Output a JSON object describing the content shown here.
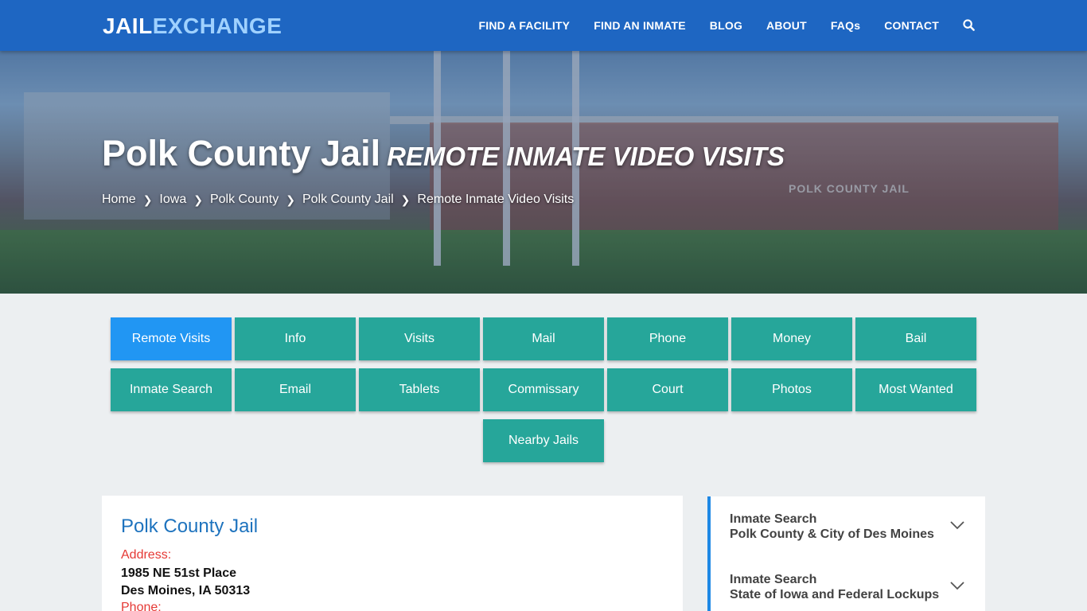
{
  "header": {
    "logo_part1": "JAIL",
    "logo_part2": "EXCHANGE",
    "nav": [
      "FIND A FACILITY",
      "FIND AN INMATE",
      "BLOG",
      "ABOUT",
      "FAQs",
      "CONTACT"
    ],
    "search_icon": "search-icon"
  },
  "hero": {
    "title": "Polk County Jail",
    "subtitle": "REMOTE INMATE VIDEO VISITS",
    "building_sign": "POLK COUNTY JAIL",
    "breadcrumb": [
      "Home",
      "Iowa",
      "Polk County",
      "Polk County Jail",
      "Remote Inmate Video Visits"
    ]
  },
  "buttons": {
    "row1": [
      "Remote Visits",
      "Info",
      "Visits",
      "Mail",
      "Phone",
      "Money",
      "Bail"
    ],
    "row2": [
      "Inmate Search",
      "Email",
      "Tablets",
      "Commissary",
      "Court",
      "Photos",
      "Most Wanted"
    ],
    "row3": [
      "Nearby Jails"
    ],
    "active": "Remote Visits"
  },
  "facility": {
    "name": "Polk County Jail",
    "address_label": "Address:",
    "address_line1": "1985 NE 51st Place",
    "address_line2": "Des Moines, IA 50313",
    "phone_label": "Phone:"
  },
  "sidebar": [
    {
      "title": "Inmate Search",
      "subtitle": "Polk County & City of Des Moines"
    },
    {
      "title": "Inmate Search",
      "subtitle": "State of Iowa and Federal Lockups"
    }
  ],
  "colors": {
    "nav_blue": "#1e66c2",
    "teal": "#26a69a",
    "active_blue": "#2196f3",
    "link_blue": "#1e73be",
    "label_red": "#e53935"
  }
}
